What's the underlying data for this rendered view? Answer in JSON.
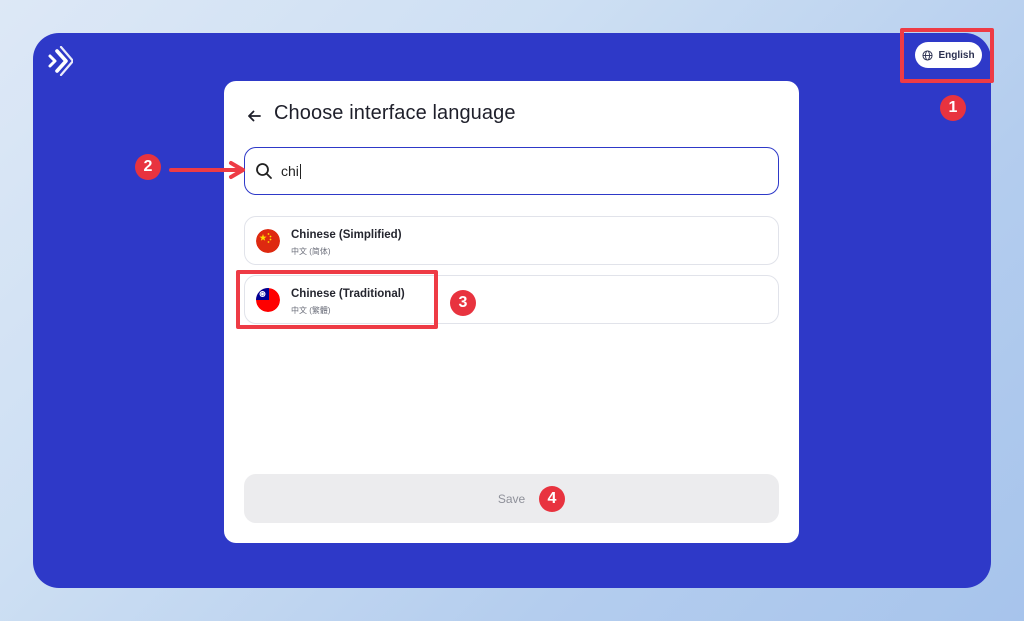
{
  "header": {
    "logo_icon": "brand-chevrons-icon",
    "language_button": {
      "label": "English",
      "icon": "globe-icon"
    }
  },
  "dialog": {
    "back_icon": "arrow-left-icon",
    "title": "Choose interface language",
    "search": {
      "value": "chi",
      "icon": "search-icon"
    },
    "options": [
      {
        "name": "Chinese (Simplified)",
        "native": "中文 (简体)",
        "flag": "flag-china-icon"
      },
      {
        "name": "Chinese (Traditional)",
        "native": "中文 (繁體)",
        "flag": "flag-taiwan-icon"
      }
    ],
    "save_label": "Save"
  },
  "annotations": {
    "steps": [
      "1",
      "2",
      "3",
      "4"
    ],
    "highlight_color": "#ee3b45",
    "badge_color": "#e8333f"
  },
  "colors": {
    "frame": "#2e39c8",
    "card": "#ffffff",
    "save_disabled_bg": "#ececee"
  }
}
